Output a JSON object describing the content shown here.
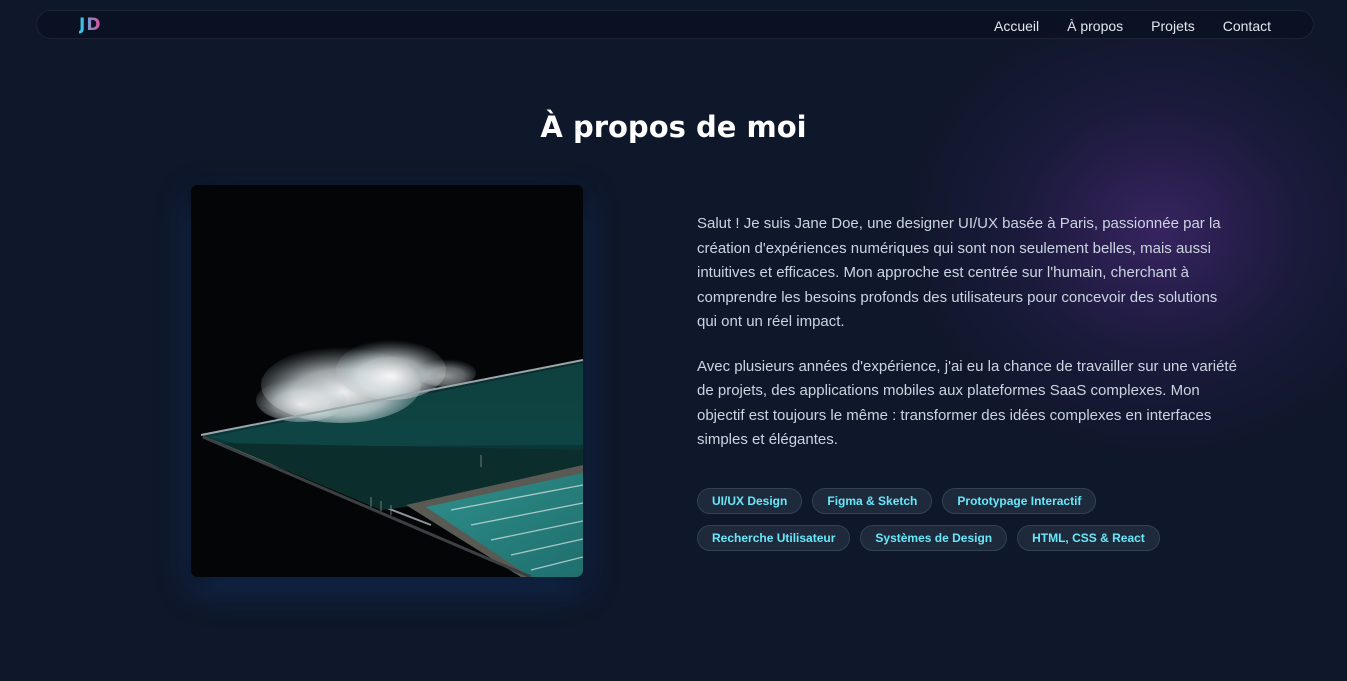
{
  "nav": {
    "logo": "JD",
    "links": [
      "Accueil",
      "À propos",
      "Projets",
      "Contact"
    ]
  },
  "about": {
    "title": "À propos de moi",
    "photo_icon": "ocean-pool-photo",
    "paragraphs": [
      "Salut ! Je suis Jane Doe, une designer UI/UX basée à Paris, passionnée par la création d'expériences numériques qui sont non seulement belles, mais aussi intuitives et efficaces. Mon approche est centrée sur l'humain, cherchant à comprendre les besoins profonds des utilisateurs pour concevoir des solutions qui ont un réel impact.",
      "Avec plusieurs années d'expérience, j'ai eu la chance de travailler sur une variété de projets, des applications mobiles aux plateformes SaaS complexes. Mon objectif est toujours le même : transformer des idées complexes en interfaces simples et élégantes."
    ],
    "skills": [
      "UI/UX Design",
      "Figma & Sketch",
      "Prototypage Interactif",
      "Recherche Utilisateur",
      "Systèmes de Design",
      "HTML, CSS & React"
    ]
  },
  "colors": {
    "background": "#0f172a",
    "accent": "#67e8f9",
    "logo_gradient_start": "#22d3ee",
    "logo_gradient_end": "#ec4899",
    "glow": "#582e8c"
  }
}
